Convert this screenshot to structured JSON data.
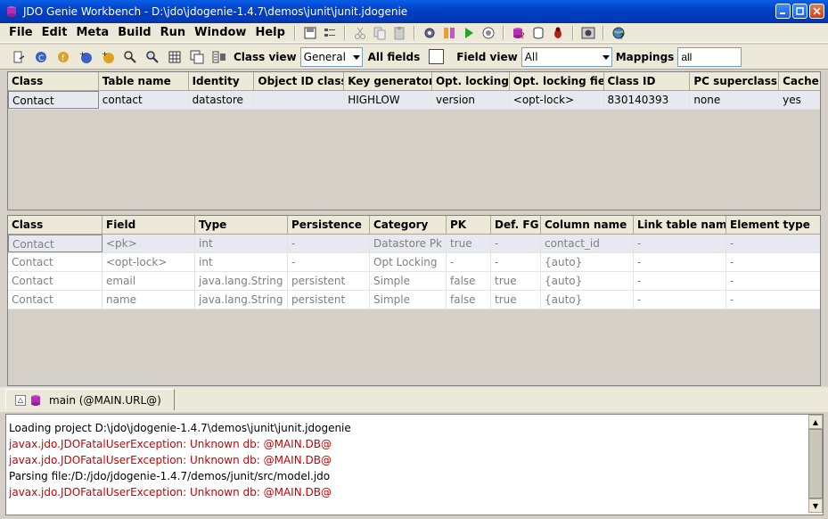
{
  "window": {
    "title": "JDO Genie Workbench - D:\\jdo\\jdogenie-1.4.7\\demos\\junit\\junit.jdogenie"
  },
  "menu": {
    "items": [
      {
        "label": "File"
      },
      {
        "label": "Edit"
      },
      {
        "label": "Meta"
      },
      {
        "label": "Build"
      },
      {
        "label": "Run"
      },
      {
        "label": "Window"
      },
      {
        "label": "Help"
      }
    ]
  },
  "toolbar": {
    "class_view_label": "Class view",
    "class_view_value": "General",
    "all_fields_label": "All fields",
    "field_view_label": "Field view",
    "field_view_value": "All",
    "mappings_label": "Mappings",
    "mappings_value": "all"
  },
  "class_table": {
    "headers": [
      "Class",
      "Table name",
      "Identity",
      "Object ID class",
      "Key generator",
      "Opt. locking",
      "Opt. locking field",
      "Class ID",
      "PC superclass",
      "Cache"
    ],
    "rows": [
      [
        "Contact",
        "contact",
        "datastore",
        "",
        "HIGHLOW",
        "version",
        "<opt-lock>",
        "830140393",
        "none",
        "yes"
      ]
    ]
  },
  "field_table": {
    "headers": [
      "Class",
      "Field",
      "Type",
      "Persistence",
      "Category",
      "PK",
      "Def. FG",
      "Column name",
      "Link table name",
      "Element type"
    ],
    "rows": [
      [
        "Contact",
        "<pk>",
        "int",
        "-",
        "Datastore Pk",
        "true",
        "-",
        "contact_id",
        "-",
        "-"
      ],
      [
        "Contact",
        "<opt-lock>",
        "int",
        "-",
        "Opt Locking",
        "-",
        "-",
        "{auto}",
        "-",
        "-"
      ],
      [
        "Contact",
        "email",
        "java.lang.String",
        "persistent",
        "Simple",
        "false",
        "true",
        "{auto}",
        "-",
        "-"
      ],
      [
        "Contact",
        "name",
        "java.lang.String",
        "persistent",
        "Simple",
        "false",
        "true",
        "{auto}",
        "-",
        "-"
      ]
    ]
  },
  "tabs": [
    {
      "label": "main (@MAIN.URL@)"
    }
  ],
  "console": {
    "lines": [
      {
        "text": "Loading project D:\\jdo\\jdogenie-1.4.7\\demos\\junit\\junit.jdogenie",
        "kind": "info"
      },
      {
        "text": "javax.jdo.JDOFatalUserException: Unknown db: @MAIN.DB@",
        "kind": "error"
      },
      {
        "text": "javax.jdo.JDOFatalUserException: Unknown db: @MAIN.DB@",
        "kind": "error"
      },
      {
        "text": "Parsing file:/D:/jdo/jdogenie-1.4.7/demos/junit/src/model.jdo",
        "kind": "info"
      },
      {
        "text": "javax.jdo.JDOFatalUserException: Unknown db: @MAIN.DB@",
        "kind": "error"
      }
    ]
  },
  "colors": {
    "titlebar": "#0042c8",
    "error_text": "#cc0000"
  }
}
